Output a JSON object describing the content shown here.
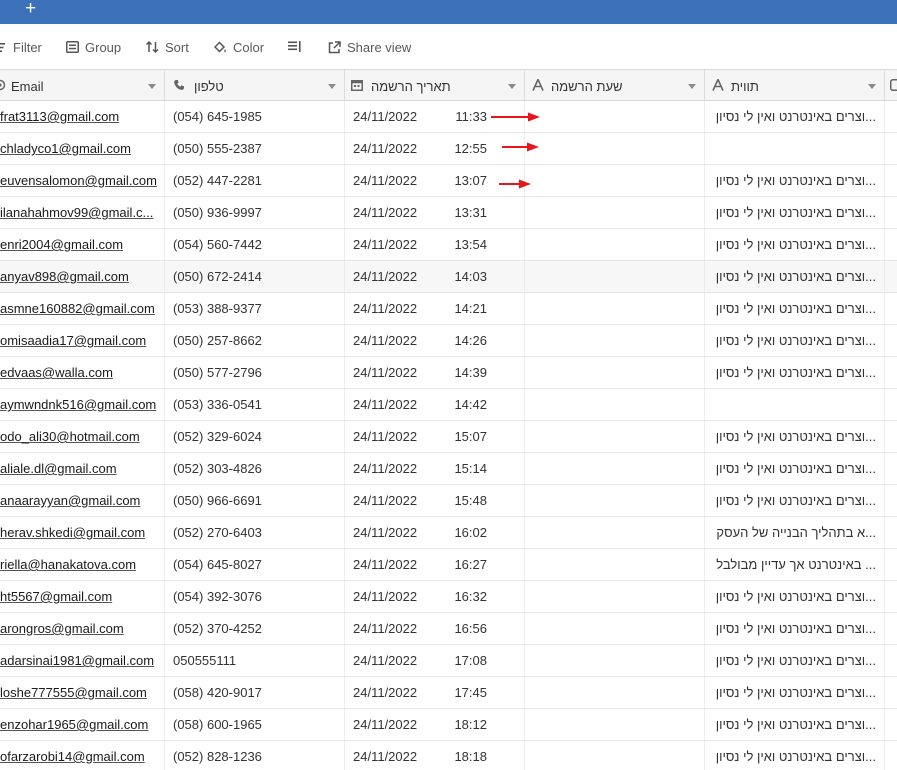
{
  "topbar": {
    "add_symbol": "+"
  },
  "toolbar": {
    "filter": "Filter",
    "group": "Group",
    "sort": "Sort",
    "color": "Color",
    "share": "Share view"
  },
  "columns": {
    "email": "Email",
    "phone": "טלפון",
    "date": "תאריך הרשמה",
    "hour": "שעת הרשמה",
    "tags": "תווית"
  },
  "rows": [
    {
      "email": "frat3113@gmail.com",
      "phone": "(054) 645-1985",
      "date": "24/11/2022",
      "time": "11:33",
      "tag": "...וצרים באינטרנט ואין לי נסיון"
    },
    {
      "email": "chladyco1@gmail.com",
      "phone": "(050) 555-2387",
      "date": "24/11/2022",
      "time": "12:55",
      "tag": ""
    },
    {
      "email": "euvensalomon@gmail.com",
      "phone": "(052) 447-2281",
      "date": "24/11/2022",
      "time": "13:07",
      "tag": "...וצרים באינטרנט ואין לי נסיון"
    },
    {
      "email": "ilanahahmov99@gmail.c...",
      "phone": "(050) 936-9997",
      "date": "24/11/2022",
      "time": "13:31",
      "tag": "...וצרים באינטרנט ואין לי נסיון"
    },
    {
      "email": "enri2004@gmail.com",
      "phone": "(054) 560-7442",
      "date": "24/11/2022",
      "time": "13:54",
      "tag": "...וצרים באינטרנט ואין לי נסיון"
    },
    {
      "email": "anyav898@gmail.com",
      "phone": "(050) 672-2414",
      "date": "24/11/2022",
      "time": "14:03",
      "tag": "...וצרים באינטרנט ואין לי נסיון"
    },
    {
      "email": "asmne160882@gmail.com",
      "phone": "(053) 388-9377",
      "date": "24/11/2022",
      "time": "14:21",
      "tag": "...וצרים באינטרנט ואין לי נסיון"
    },
    {
      "email": "omisaadia17@gmail.com",
      "phone": "(050) 257-8662",
      "date": "24/11/2022",
      "time": "14:26",
      "tag": "...וצרים באינטרנט ואין לי נסיון"
    },
    {
      "email": "edvaas@walla.com",
      "phone": "(050) 577-2796",
      "date": "24/11/2022",
      "time": "14:39",
      "tag": "...וצרים באינטרנט ואין לי נסיון"
    },
    {
      "email": "aymwndnk516@gmail.com",
      "phone": "(053) 336-0541",
      "date": "24/11/2022",
      "time": "14:42",
      "tag": ""
    },
    {
      "email": "odo_ali30@hotmail.com",
      "phone": "(052) 329-6024",
      "date": "24/11/2022",
      "time": "15:07",
      "tag": "...וצרים באינטרנט ואין לי נסיון"
    },
    {
      "email": "aliale.dl@gmail.com",
      "phone": "(052) 303-4826",
      "date": "24/11/2022",
      "time": "15:14",
      "tag": "...וצרים באינטרנט ואין לי נסיון"
    },
    {
      "email": "anaarayyan@gmail.com",
      "phone": "(050) 966-6691",
      "date": "24/11/2022",
      "time": "15:48",
      "tag": "...וצרים באינטרנט ואין לי נסיון"
    },
    {
      "email": "herav.shkedi@gmail.com",
      "phone": "(052) 270-6403",
      "date": "24/11/2022",
      "time": "16:02",
      "tag": "...א בתהליך הבנייה של העסק"
    },
    {
      "email": "riella@hanakatova.com",
      "phone": "(054) 645-8027",
      "date": "24/11/2022",
      "time": "16:27",
      "tag": "... באינטרנט אך עדיין מבולבל"
    },
    {
      "email": "ht5567@gmail.com",
      "phone": "(054) 392-3076",
      "date": "24/11/2022",
      "time": "16:32",
      "tag": "...וצרים באינטרנט ואין לי נסיון"
    },
    {
      "email": "arongros@gmail.com",
      "phone": "(052) 370-4252",
      "date": "24/11/2022",
      "time": "16:56",
      "tag": "...וצרים באינטרנט ואין לי נסיון"
    },
    {
      "email": "adarsinai1981@gmail.com",
      "phone": "050555111",
      "date": "24/11/2022",
      "time": "17:08",
      "tag": "...וצרים באינטרנט ואין לי נסיון"
    },
    {
      "email": "loshe777555@gmail.com",
      "phone": "(058) 420-9017",
      "date": "24/11/2022",
      "time": "17:45",
      "tag": "...וצרים באינטרנט ואין לי נסיון"
    },
    {
      "email": "enzohar1965@gmail.com",
      "phone": "(058) 600-1965",
      "date": "24/11/2022",
      "time": "18:12",
      "tag": "...וצרים באינטרנט ואין לי נסיון"
    },
    {
      "email": "ofarzarobi14@gmail.com",
      "phone": "(052) 828-1236",
      "date": "24/11/2022",
      "time": "18:18",
      "tag": "...וצרים באינטרנט ואין לי נסיון"
    }
  ],
  "colors": {
    "topbar": "#3a71b8",
    "arrow": "#e8141e",
    "header_bg": "#f5f5f5",
    "highlight_row": "#f7f7f7"
  }
}
